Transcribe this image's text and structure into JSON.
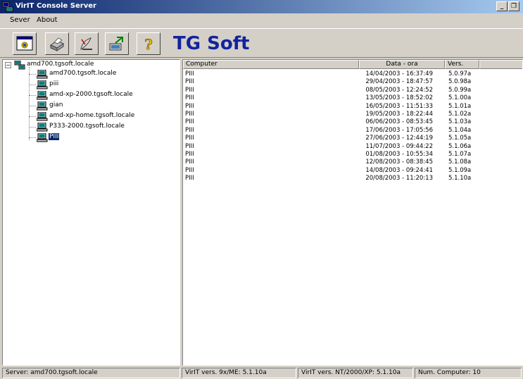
{
  "window": {
    "title": "VirIT Console Server",
    "min_label": "_",
    "restore_label": "❐"
  },
  "menu": {
    "items": [
      "Sever",
      "About"
    ]
  },
  "toolbar": {
    "brand": "TG Soft",
    "help_glyph": "?"
  },
  "tree": {
    "root": "amd700.tgsoft.locale",
    "children": [
      "amd700.tgsoft.locale",
      "piii",
      "amd-xp-2000.tgsoft.locale",
      "gian",
      "amd-xp-home.tgsoft.locale",
      "P333-2000.tgsoft.locale",
      "PIII"
    ],
    "selected_index": 6
  },
  "list": {
    "columns": [
      "Computer",
      "Data - ora",
      "Vers."
    ],
    "rows": [
      [
        "PIII",
        "14/04/2003 - 16:37:49",
        "5.0.97a"
      ],
      [
        "PIII",
        "29/04/2003 - 18:47:57",
        "5.0.98a"
      ],
      [
        "PIII",
        "08/05/2003 - 12:24:52",
        "5.0.99a"
      ],
      [
        "PIII",
        "13/05/2003 - 18:52:02",
        "5.1.00a"
      ],
      [
        "PIII",
        "16/05/2003 - 11:51:33",
        "5.1.01a"
      ],
      [
        "PIII",
        "19/05/2003 - 18:22:44",
        "5.1.02a"
      ],
      [
        "PIII",
        "06/06/2003 - 08:53:45",
        "5.1.03a"
      ],
      [
        "PIII",
        "17/06/2003 - 17:05:56",
        "5.1.04a"
      ],
      [
        "PIII",
        "27/06/2003 - 12:44:19",
        "5.1.05a"
      ],
      [
        "PIII",
        "11/07/2003 - 09:44:22",
        "5.1.06a"
      ],
      [
        "PIII",
        "01/08/2003 - 10:55:34",
        "5.1.07a"
      ],
      [
        "PIII",
        "12/08/2003 - 08:38:45",
        "5.1.08a"
      ],
      [
        "PIII",
        "14/08/2003 - 09:24:41",
        "5.1.09a"
      ],
      [
        "PIII",
        "20/08/2003 - 11:20:13",
        "5.1.10a"
      ]
    ]
  },
  "status": {
    "server": "Server: amd700.tgsoft.locale",
    "ver_9x": "VirIT vers. 9x/ME: 5.1.10a",
    "ver_nt": "VirIT vers. NT/2000/XP: 5.1.10a",
    "num_computer": "Num. Computer: 10"
  },
  "colors": {
    "titlebar_start": "#0a246a",
    "titlebar_end": "#a6caf0",
    "brand": "#13239e",
    "selection": "#0a246a"
  }
}
